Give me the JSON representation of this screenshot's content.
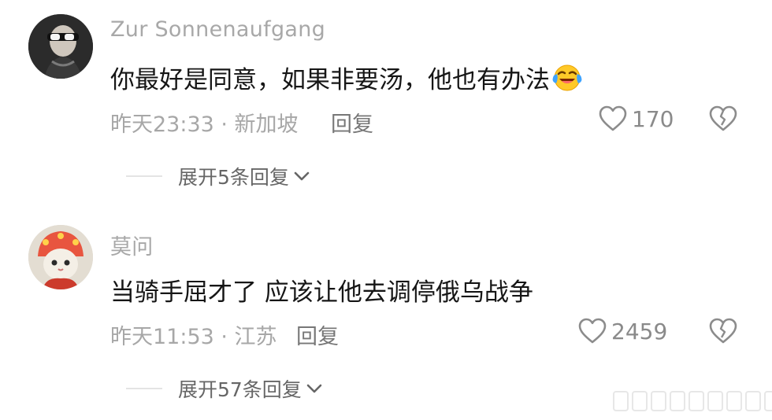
{
  "comments": [
    {
      "username": "Zur Sonnenaufgang",
      "text": "你最好是同意，如果非要汤，他也有办法",
      "time_location": "昨天23:33 · 新加坡",
      "reply_label": "回复",
      "likes": "170",
      "expand_label": "展开5条回复",
      "emoji_icon": "laughing-tears-emoji-icon"
    },
    {
      "username": "莫问",
      "text": "当骑手屈才了 应该让他去调停俄乌战争",
      "time_location": "昨天11:53 · 江苏",
      "reply_label": "回复",
      "likes": "2459",
      "expand_label": "展开57条回复"
    }
  ],
  "colors": {
    "username": "#a8a8a8",
    "text": "#161616",
    "meta": "#a7a7a7",
    "icon_stroke": "#8c8c8c"
  }
}
